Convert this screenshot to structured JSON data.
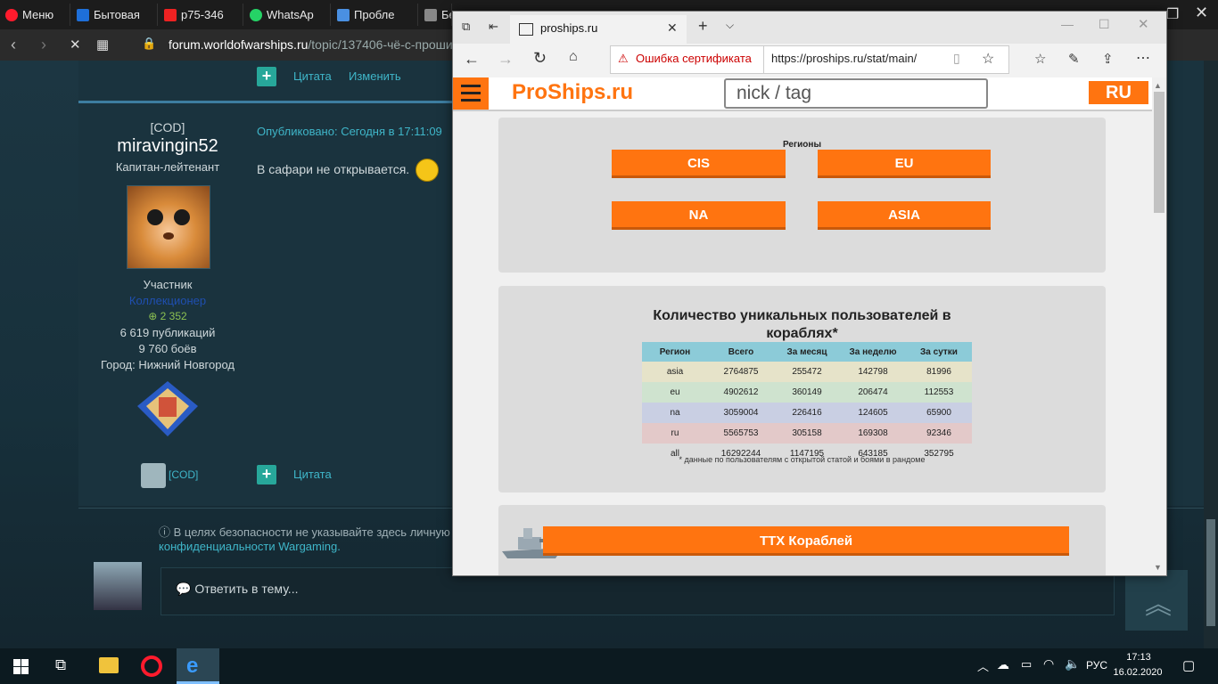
{
  "opera": {
    "menu_label": "Меню",
    "tabs": [
      {
        "label": "Бытовая",
        "color": "#1e6fd9"
      },
      {
        "label": "р75-346",
        "color": "#e22"
      },
      {
        "label": "WhatsAp",
        "color": "#25d366"
      },
      {
        "label": "Пробле",
        "color": "#4a90e2"
      },
      {
        "label": "Бе",
        "color": "#888"
      }
    ],
    "url_domain": "forum.worldofwarships.ru",
    "url_path": "/topic/137406-чё-с-проши"
  },
  "forum": {
    "top_actions": {
      "quote": "Цитата",
      "edit": "Изменить"
    },
    "clan": "[COD]",
    "username": "miravingin52",
    "rank": "Капитан-лейтенант",
    "group": "Участник",
    "badge": "Коллекционер",
    "karma": "2 352",
    "posts": "6 619 публикаций",
    "battles": "9 760 боёв",
    "city": "Город: Нижний Новгород",
    "published": "Опубликовано: Сегодня в 17:11:09",
    "post_text": "В сафари не открывается.",
    "footer_clan": "[COD]",
    "footer_quote": "Цитата",
    "security_notice": "В целях безопасности не указывайте здесь личную",
    "privacy_link": "конфиденциальности Wargaming.",
    "reply_placeholder": "Ответить в тему..."
  },
  "edge": {
    "tab_title": "proships.ru",
    "cert_error": "Ошибка сертификата",
    "url": "https://proships.ru/stat/main/"
  },
  "proships": {
    "logo": "ProShips.ru",
    "search_placeholder": "nick / tag",
    "lang": "RU",
    "regions_label": "Регионы",
    "regions": [
      "CIS",
      "EU",
      "NA",
      "ASIA"
    ],
    "stats_title_1": "Количество уникальных пользователей в",
    "stats_title_2": "кораблях*",
    "table": {
      "headers": [
        "Регион",
        "Всего",
        "За месяц",
        "За неделю",
        "За сутки"
      ],
      "rows": [
        {
          "cells": [
            "asia",
            "2764875",
            "255472",
            "142798",
            "81996"
          ],
          "color": "#e6e3c9"
        },
        {
          "cells": [
            "eu",
            "4902612",
            "360149",
            "206474",
            "112553"
          ],
          "color": "#cfe3cf"
        },
        {
          "cells": [
            "na",
            "3059004",
            "226416",
            "124605",
            "65900"
          ],
          "color": "#c9cfe3"
        },
        {
          "cells": [
            "ru",
            "5565753",
            "305158",
            "169308",
            "92346"
          ],
          "color": "#e3c9c9"
        },
        {
          "cells": [
            "all",
            "16292244",
            "1147195",
            "643185",
            "352795"
          ],
          "color": "#dcdcdc"
        }
      ]
    },
    "footnote": "* данные по пользователям с открытой статой и боями в рандоме",
    "ships_button": "ТТХ Кораблей"
  },
  "taskbar": {
    "lang": "РУС",
    "time": "17:13",
    "date": "16.02.2020"
  }
}
